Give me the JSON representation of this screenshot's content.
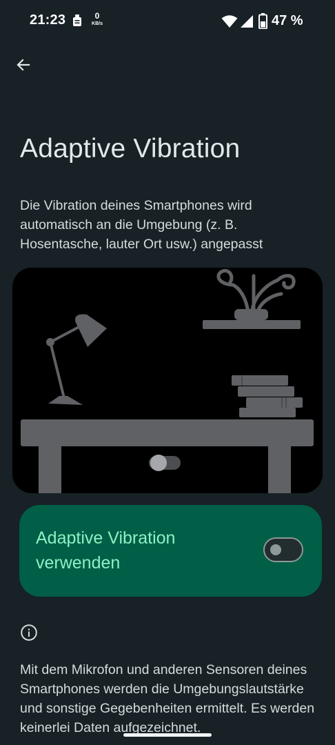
{
  "status_bar": {
    "time": "21:23",
    "net_speed_value": "0",
    "net_speed_unit": "KB/s",
    "battery_percent": "47 %",
    "icons": [
      "notification-icon",
      "wifi-icon",
      "cell-signal-icon",
      "battery-icon"
    ]
  },
  "header": {
    "back_icon": "arrow-back-icon"
  },
  "page": {
    "title": "Adaptive Vibration",
    "description": "Die Vibration deines Smartphones wird automatisch an die Umgebung (z. B. Hosentasche, lauter Ort usw.) angepasst"
  },
  "setting": {
    "label": "Adaptive Vibration verwenden",
    "enabled": false
  },
  "footer": {
    "info_icon": "info-icon",
    "info_text": "Mit dem Mikrofon und anderen Sensoren deines Smartphones werden die Umgebungslautstärke und sonstige Gegebenheiten ermittelt. Es werden keinerlei Daten aufgezeichnet."
  },
  "colors": {
    "background": "#172126",
    "card": "#005f46",
    "card_text": "#8ff0c4",
    "illustration_bg": "#000000",
    "illustration_gray": "#5f6164"
  }
}
